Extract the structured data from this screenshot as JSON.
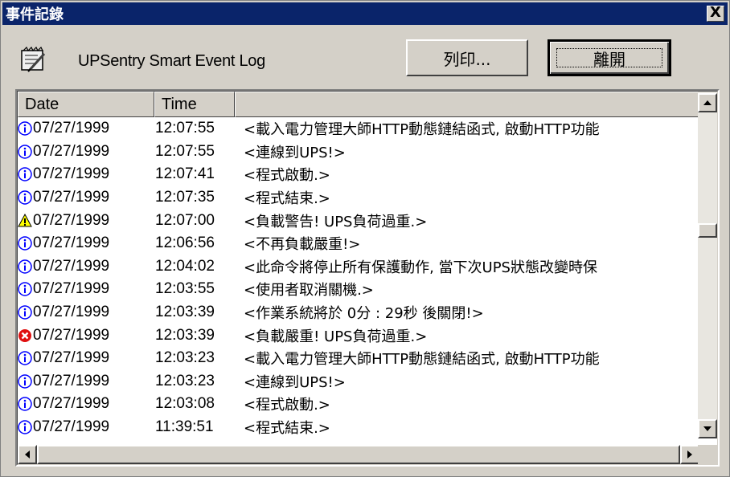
{
  "window": {
    "title": "事件記錄",
    "close_label": "X"
  },
  "header": {
    "app_title": "UPSentry Smart Event Log"
  },
  "buttons": {
    "print": "列印...",
    "close": "離開"
  },
  "columns": {
    "date": "Date",
    "time": "Time",
    "message": ""
  },
  "events": [
    {
      "icon": "info-icon",
      "date": "07/27/1999",
      "time": "12:07:55",
      "message": "<載入電力管理大師HTTP動態鏈結函式, 啟動HTTP功能"
    },
    {
      "icon": "info-icon",
      "date": "07/27/1999",
      "time": "12:07:55",
      "message": "<連線到UPS!>"
    },
    {
      "icon": "info-icon",
      "date": "07/27/1999",
      "time": "12:07:41",
      "message": "<程式啟動.>"
    },
    {
      "icon": "info-icon",
      "date": "07/27/1999",
      "time": "12:07:35",
      "message": "<程式結束.>"
    },
    {
      "icon": "warning-icon",
      "date": "07/27/1999",
      "time": "12:07:00",
      "message": "<負載警告! UPS負荷過重.>"
    },
    {
      "icon": "info-icon",
      "date": "07/27/1999",
      "time": "12:06:56",
      "message": "<不再負載嚴重!>"
    },
    {
      "icon": "info-icon",
      "date": "07/27/1999",
      "time": "12:04:02",
      "message": "<此命令將停止所有保護動作, 當下次UPS狀態改變時保"
    },
    {
      "icon": "info-icon",
      "date": "07/27/1999",
      "time": "12:03:55",
      "message": "<使用者取消關機.>"
    },
    {
      "icon": "info-icon",
      "date": "07/27/1999",
      "time": "12:03:39",
      "message": "<作業系統將於 0分 : 29秒 後關閉!>"
    },
    {
      "icon": "error-icon",
      "date": "07/27/1999",
      "time": "12:03:39",
      "message": "<負載嚴重! UPS負荷過重.>"
    },
    {
      "icon": "info-icon",
      "date": "07/27/1999",
      "time": "12:03:23",
      "message": "<載入電力管理大師HTTP動態鏈結函式, 啟動HTTP功能"
    },
    {
      "icon": "info-icon",
      "date": "07/27/1999",
      "time": "12:03:23",
      "message": "<連線到UPS!>"
    },
    {
      "icon": "info-icon",
      "date": "07/27/1999",
      "time": "12:03:08",
      "message": "<程式啟動.>"
    },
    {
      "icon": "info-icon",
      "date": "07/27/1999",
      "time": "11:39:51",
      "message": "<程式結束.>"
    }
  ],
  "colors": {
    "titlebar": "#0a246a",
    "info": "#0000ff",
    "warning": "#ffff00",
    "error": "#e01010"
  }
}
